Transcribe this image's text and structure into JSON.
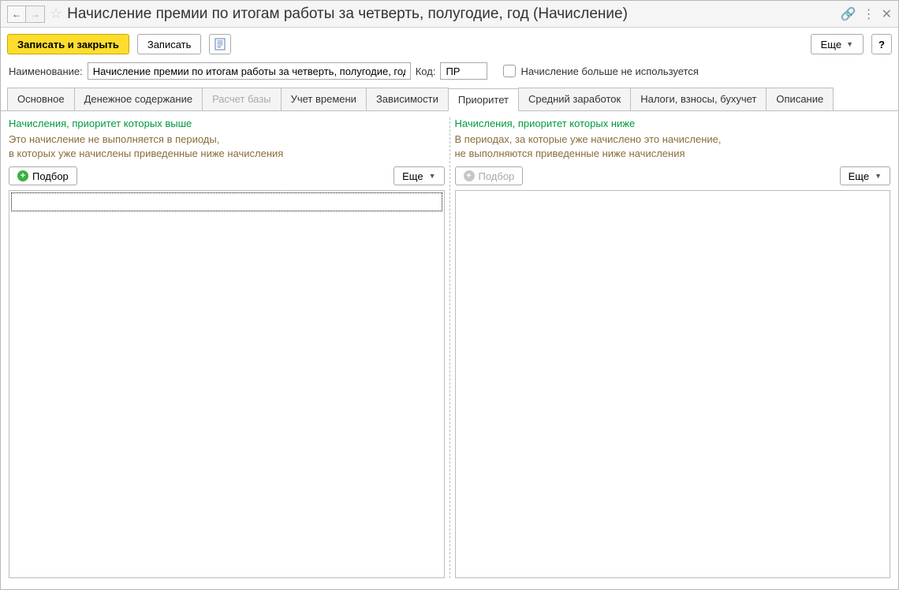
{
  "titlebar": {
    "title": "Начисление премии по итогам работы за четверть, полугодие, год (Начисление)"
  },
  "toolbar": {
    "save_close": "Записать и закрыть",
    "save": "Записать",
    "more": "Еще",
    "help": "?"
  },
  "form": {
    "name_label": "Наименование:",
    "name_value": "Начисление премии по итогам работы за четверть, полугодие, год",
    "code_label": "Код:",
    "code_value": "ПР",
    "not_used_label": "Начисление больше не используется"
  },
  "tabs": [
    {
      "id": "main",
      "label": "Основное"
    },
    {
      "id": "money",
      "label": "Денежное содержание"
    },
    {
      "id": "basecalc",
      "label": "Расчет базы",
      "disabled": true
    },
    {
      "id": "time",
      "label": "Учет времени"
    },
    {
      "id": "deps",
      "label": "Зависимости"
    },
    {
      "id": "priority",
      "label": "Приоритет",
      "active": true
    },
    {
      "id": "avg",
      "label": "Средний заработок"
    },
    {
      "id": "tax",
      "label": "Налоги, взносы, бухучет"
    },
    {
      "id": "desc",
      "label": "Описание"
    }
  ],
  "left": {
    "heading": "Начисления, приоритет которых выше",
    "note_l1": "Это начисление не выполняется в периоды,",
    "note_l2": "в которых уже начислены приведенные ниже начисления",
    "pick": "Подбор",
    "more": "Еще"
  },
  "right": {
    "heading": "Начисления, приоритет которых ниже",
    "note_l1": "В периодах, за которые уже начислено это начисление,",
    "note_l2": "не выполняются приведенные ниже начисления",
    "pick": "Подбор",
    "more": "Еще"
  }
}
